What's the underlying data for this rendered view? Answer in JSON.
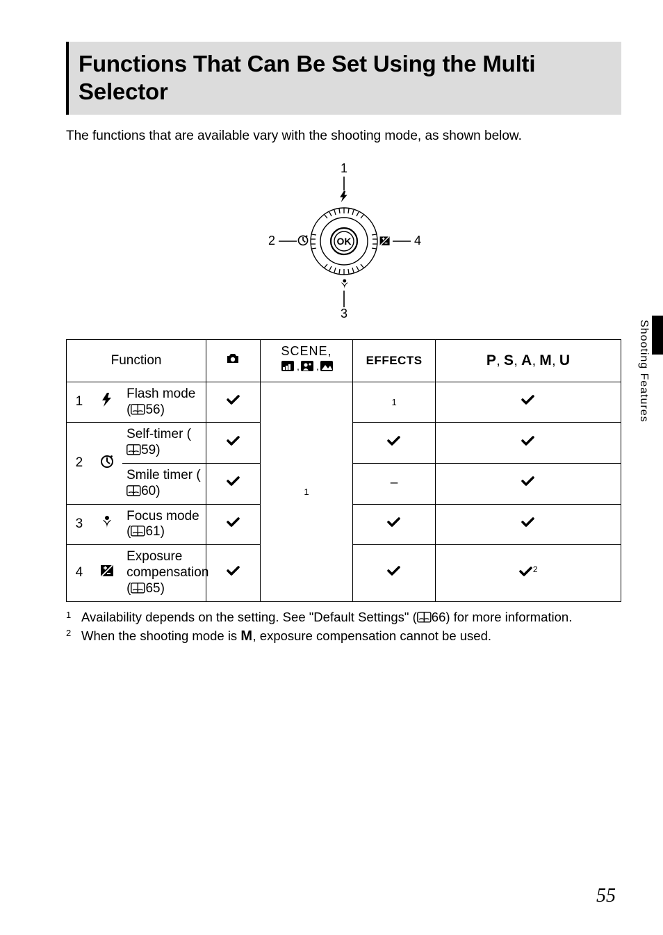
{
  "title": "Functions That Can Be Set Using the Multi Selector",
  "intro": "The functions that are available vary with the shooting mode, as shown below.",
  "diagram": {
    "labels": {
      "top": "1",
      "left": "2",
      "bottom": "3",
      "right": "4"
    }
  },
  "table": {
    "headers": {
      "function": "Function",
      "scene": "SCENE,",
      "effects": "EFFECTS",
      "psamu_parts": [
        "P",
        ", ",
        "S",
        ", ",
        "A",
        ", ",
        "M",
        ", ",
        "U"
      ]
    },
    "rows": [
      {
        "num": "1",
        "icon": "flash",
        "label": "Flash mode (",
        "ref": "56",
        "label_after": ")",
        "auto": "check",
        "effects": "sup1",
        "psamu": "check",
        "rowspan_num": 1
      },
      {
        "num": "2",
        "icon": "timer",
        "label": "Self-timer (",
        "ref": "59",
        "label_after": ")",
        "auto": "check",
        "effects": "check",
        "psamu": "check",
        "rowspan_num": 2
      },
      {
        "num": "",
        "icon": "",
        "label": "Smile timer (",
        "ref": "60",
        "label_after": ")",
        "auto": "check",
        "effects": "dash",
        "psamu": "check",
        "rowspan_num": 0
      },
      {
        "num": "3",
        "icon": "macro",
        "label": "Focus mode (",
        "ref": "61",
        "label_after": ")",
        "auto": "check",
        "effects": "check",
        "psamu": "check",
        "rowspan_num": 1
      },
      {
        "num": "4",
        "icon": "exp",
        "label_lines": [
          "Exposure",
          "compensation ("
        ],
        "ref": "65",
        "label_after": ")",
        "auto": "check",
        "effects": "check",
        "psamu": "check_sup2",
        "rowspan_num": 1
      }
    ],
    "scene_center_note": "1"
  },
  "footnotes": [
    {
      "num": "1",
      "text_before": "Availability depends on the setting. See \"Default Settings\" (",
      "ref": "66",
      "text_after": ") for more information."
    },
    {
      "num": "2",
      "text_before": "When the shooting mode is ",
      "bold": "M",
      "text_after": ", exposure compensation cannot be used."
    }
  ],
  "sidetab": "Shooting Features",
  "pagenum": "55",
  "chart_data": {
    "type": "table",
    "columns": [
      "Function",
      "Auto mode",
      "SCENE / Easy panorama / Smart portrait / Night landscape",
      "EFFECTS",
      "P, S, A, M, U"
    ],
    "rows": [
      [
        "Flash mode (p.56)",
        "yes",
        "note1",
        "note1",
        "yes"
      ],
      [
        "Self-timer (p.59)",
        "yes",
        "note1",
        "yes",
        "yes"
      ],
      [
        "Smile timer (p.60)",
        "yes",
        "note1",
        "no",
        "yes"
      ],
      [
        "Focus mode (p.61)",
        "yes",
        "note1",
        "yes",
        "yes"
      ],
      [
        "Exposure compensation (p.65)",
        "yes",
        "note1",
        "yes",
        "yes (note2)"
      ]
    ]
  }
}
